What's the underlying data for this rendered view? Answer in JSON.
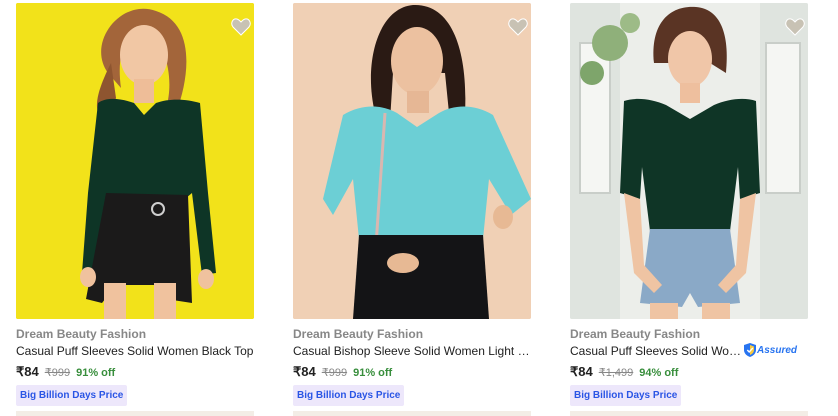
{
  "products": [
    {
      "brand": "Dream Beauty Fashion",
      "title": "Casual Puff Sleeves Solid Women Black Top",
      "price": "₹84",
      "mrp": "₹999",
      "discount": "91% off",
      "badge": "Big Billion Days Price",
      "assured": false,
      "image_icon": "product-photo-green-top-yellow-bg"
    },
    {
      "brand": "Dream Beauty Fashion",
      "title": "Casual Bishop Sleeve Solid Women Light Gre...",
      "price": "₹84",
      "mrp": "₹999",
      "discount": "91% off",
      "badge": "Big Billion Days Price",
      "assured": false,
      "image_icon": "product-photo-blue-top-beige-bg"
    },
    {
      "brand": "Dream Beauty Fashion",
      "title": "Casual Puff Sleeves Solid Wome...",
      "price": "₹84",
      "mrp": "₹1,499",
      "discount": "94% off",
      "badge": "Big Billion Days Price",
      "assured": true,
      "assured_label": "Assured",
      "image_icon": "product-photo-green-top-window-bg"
    }
  ],
  "colors": {
    "discount": "#388e3c",
    "badge_bg": "#ede7fb",
    "badge_text": "#2a55e5",
    "assured_blue": "#2874f0"
  },
  "icons": [
    "heart-icon",
    "assured-shield-icon"
  ]
}
